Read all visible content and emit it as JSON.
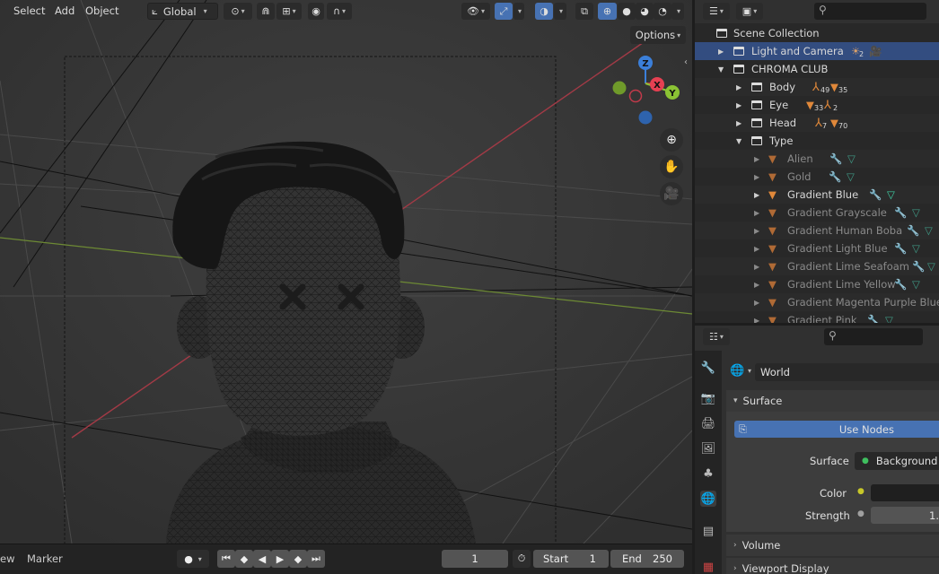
{
  "viewport": {
    "menus": [
      "Select",
      "Add",
      "Object"
    ],
    "orientation": "Global",
    "options_label": "Options",
    "gizmo_axes": {
      "z": "Z",
      "x": "X",
      "y": "Y"
    }
  },
  "timeline": {
    "view_label": "ew",
    "marker_label": "Marker",
    "current_frame": "1",
    "start_label": "Start",
    "start_value": "1",
    "end_label": "End",
    "end_value": "250"
  },
  "outliner": {
    "scene_collection": "Scene Collection",
    "rows": [
      {
        "label": "Light and Camera",
        "badge": "2",
        "depth": 1,
        "selected": true,
        "dim": false
      },
      {
        "label": "CHROMA CLUB",
        "depth": 1,
        "dim": false
      },
      {
        "label": "Body",
        "badge1": "49",
        "badge2": "35",
        "depth": 2,
        "dim": false
      },
      {
        "label": "Eye",
        "badge1": "33",
        "badge2": "2",
        "depth": 2,
        "dim": false
      },
      {
        "label": "Head",
        "badge1": "7",
        "badge2": "70",
        "depth": 2,
        "dim": false
      },
      {
        "label": "Type",
        "depth": 2,
        "dim": false
      },
      {
        "label": "Alien",
        "depth": 3,
        "dim": true
      },
      {
        "label": "Gold",
        "depth": 3,
        "dim": true
      },
      {
        "label": "Gradient Blue",
        "depth": 3,
        "dim": false
      },
      {
        "label": "Gradient Grayscale",
        "depth": 3,
        "dim": true
      },
      {
        "label": "Gradient Human Boba",
        "depth": 3,
        "dim": true
      },
      {
        "label": "Gradient Light Blue",
        "depth": 3,
        "dim": true
      },
      {
        "label": "Gradient Lime Seafoam",
        "depth": 3,
        "dim": true
      },
      {
        "label": "Gradient Lime Yellow",
        "depth": 3,
        "dim": true
      },
      {
        "label": "Gradient Magenta Purple Blue",
        "depth": 3,
        "dim": true
      },
      {
        "label": "Gradient Pink",
        "depth": 3,
        "dim": true
      }
    ]
  },
  "properties": {
    "world_name": "World",
    "surface_header": "Surface",
    "use_nodes": "Use Nodes",
    "surface_label": "Surface",
    "surface_value": "Background",
    "color_label": "Color",
    "strength_label": "Strength",
    "strength_value": "1.",
    "volume_header": "Volume",
    "viewport_display_header": "Viewport Display"
  },
  "colors": {
    "accent": "#4772b3",
    "selection": "#334d80",
    "x_axis": "#e64052",
    "y_axis": "#8bc334",
    "z_axis": "#3b7fd9"
  }
}
